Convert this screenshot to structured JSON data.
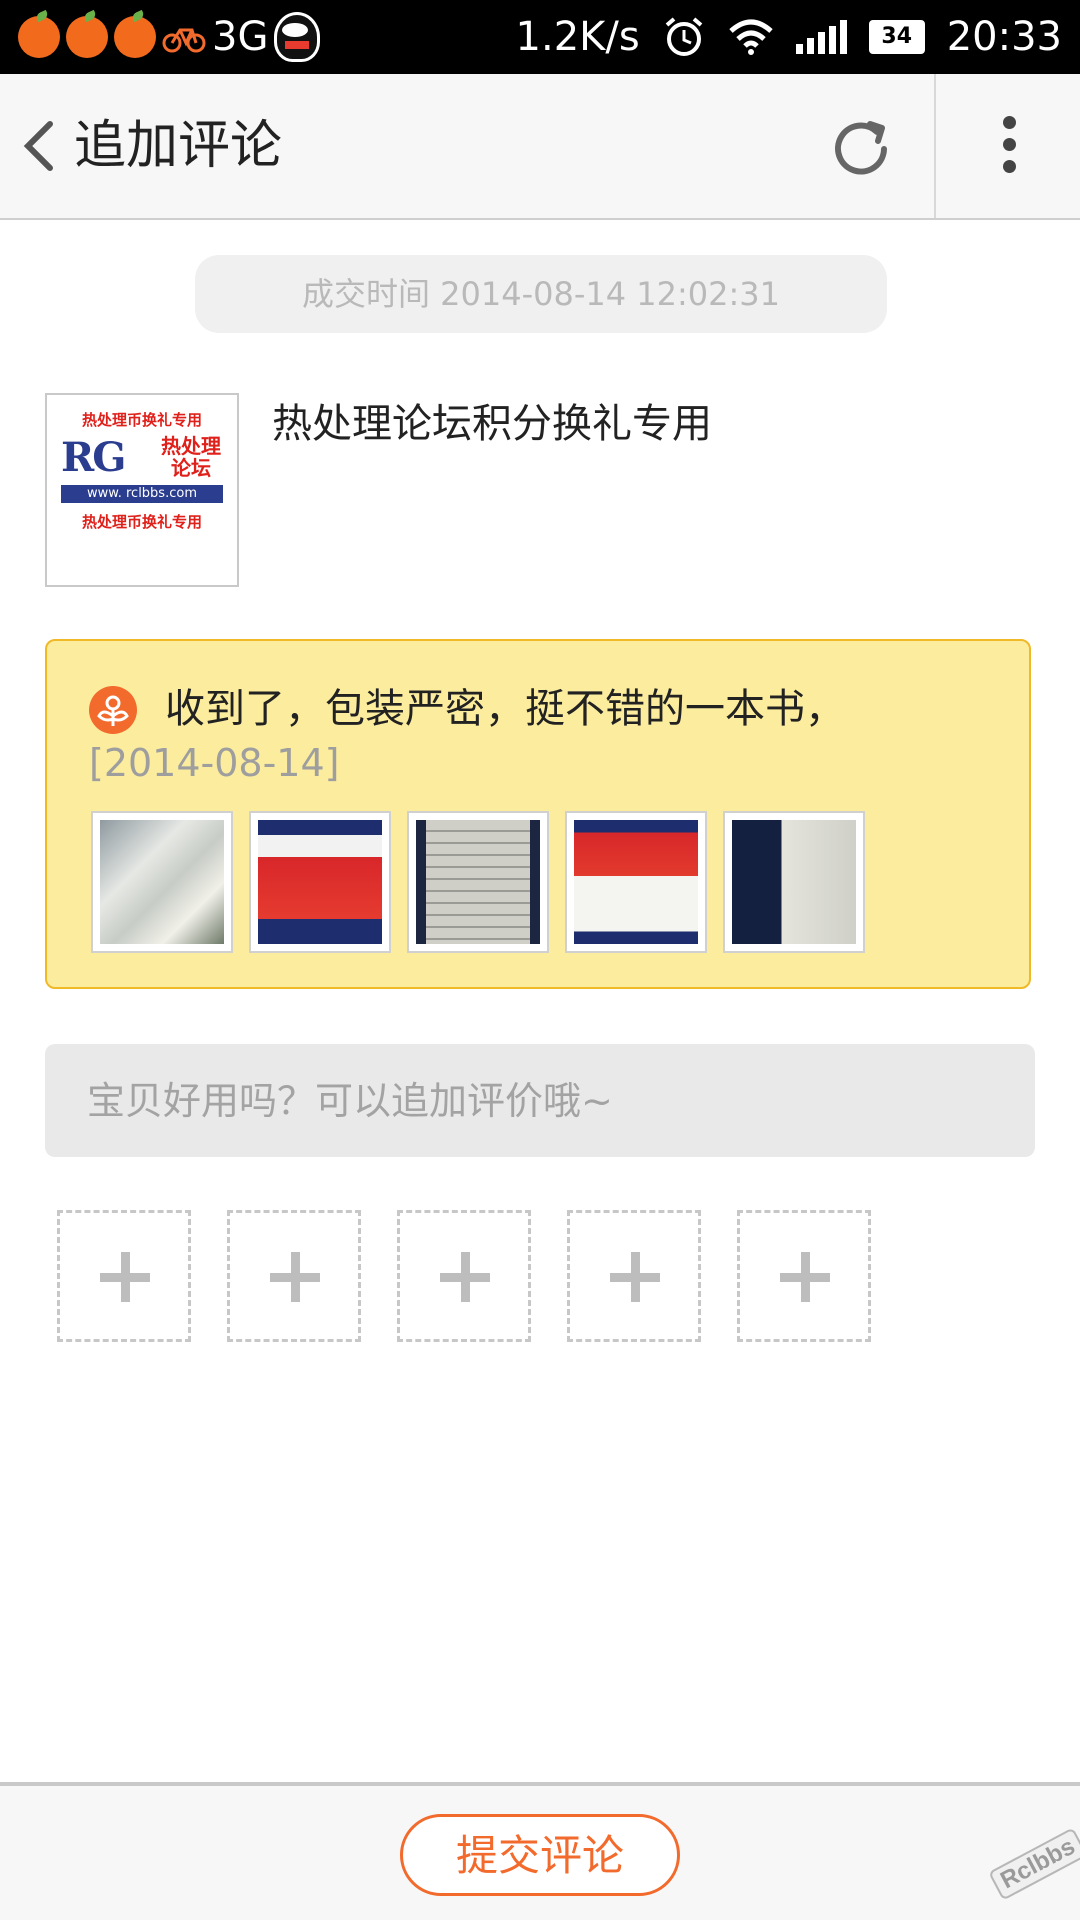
{
  "status_bar": {
    "network": "3G",
    "speed": "1.2K/s",
    "battery": "34",
    "time": "20:33"
  },
  "header": {
    "title": "追加评论"
  },
  "order": {
    "deal_time": "成交时间 2014-08-14 12:02:31"
  },
  "product": {
    "name": "热处理论坛积分换礼专用",
    "image": {
      "top_text": "热处理币换礼专用",
      "logo": "RG",
      "logo_cn": "热处理论坛",
      "url": "www. rclbbs.com",
      "bottom_text": "热处理币换礼专用"
    }
  },
  "review": {
    "text": "收到了，包装严密，挺不错的一本书，",
    "date": "[2014-08-14]",
    "photo_count": 5
  },
  "append": {
    "placeholder": "宝贝好用吗？可以追加评价哦~",
    "add_photo_slots": 5
  },
  "footer": {
    "submit_label": "提交评论"
  },
  "watermark": "Rclbbs",
  "colors": {
    "accent": "#f26a2c",
    "review_bg": "#fbec9e",
    "review_border": "#efb928"
  }
}
